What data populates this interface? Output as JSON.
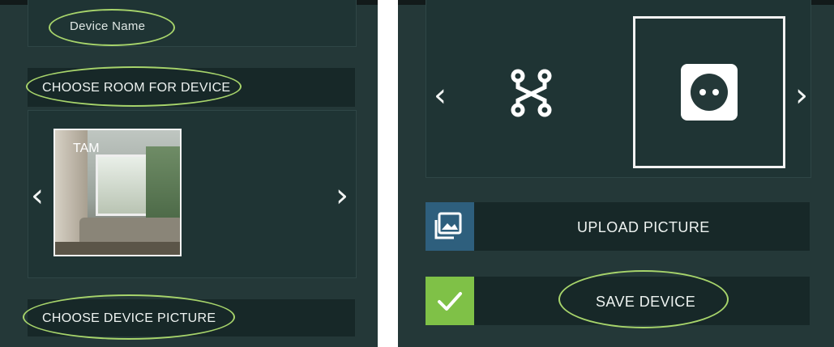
{
  "left": {
    "device_name_placeholder": "Device Name",
    "choose_room_label": "CHOOSE ROOM FOR DEVICE",
    "room": {
      "label": "TAM"
    },
    "choose_picture_label": "CHOOSE DEVICE PICTURE"
  },
  "right": {
    "upload_label": "UPLOAD PICTURE",
    "save_label": "SAVE DEVICE"
  },
  "icons": {
    "prev": "chevron-left-icon",
    "next": "chevron-right-icon",
    "graph": "graph-nodes-icon",
    "socket": "power-socket-icon",
    "gallery": "image-gallery-icon",
    "check": "checkmark-icon"
  },
  "colors": {
    "background": "#243838",
    "bar": "#172828",
    "highlight_oval": "#a7d46b",
    "upload_icon_bg": "#2e5f7d",
    "save_icon_bg": "#7fc147"
  }
}
